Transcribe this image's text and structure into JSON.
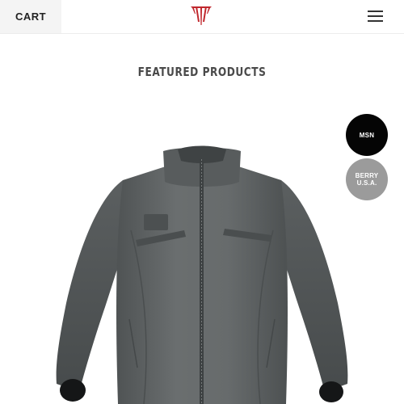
{
  "header": {
    "cart_label": "CART",
    "logo_icon": "brand-logo-icon",
    "menu_icon": "hamburger-menu-icon",
    "accent_color": "#c0272d"
  },
  "featured": {
    "title": "FEATURED PRODUCTS"
  },
  "badges": [
    {
      "label": "MSN",
      "color": "#050505"
    },
    {
      "line1": "BERRY",
      "line2": "U.S.A.",
      "color": "#9b9b9b"
    }
  ],
  "product": {
    "image": "gray-insulated-jacket",
    "color": "#5f6364"
  }
}
